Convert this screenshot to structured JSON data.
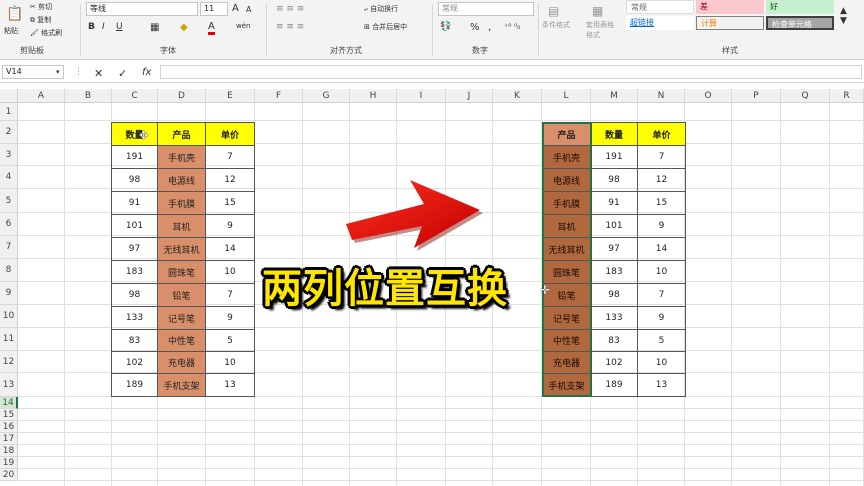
{
  "ribbon": {
    "clipboard": {
      "paste": "粘贴",
      "cut": "剪切",
      "copy": "复制",
      "format_painter": "格式刷",
      "group": "剪贴板"
    },
    "font": {
      "name": "等线",
      "size": "11",
      "bold": "B",
      "italic": "I",
      "underline": "U",
      "grow": "A",
      "shrink": "A",
      "font_color": "A",
      "wen": "wén",
      "group": "字体"
    },
    "alignment": {
      "wrap": "自动换行",
      "merge": "合并后居中",
      "group": "对齐方式"
    },
    "number": {
      "format": "常规",
      "percent": "%",
      "comma": ",",
      "group": "数字"
    },
    "styles": {
      "conditional": "条件格式",
      "table": "套用表格格式",
      "normal": "常规",
      "bad": "差",
      "good": "好",
      "hyperlink": "超链接",
      "calc": "计算",
      "check": "检查单元格",
      "group": "样式"
    }
  },
  "formula_bar": {
    "name_box": "V14",
    "cancel": "✕",
    "enter": "✓",
    "fx": "fx",
    "value": ""
  },
  "columns": [
    "A",
    "B",
    "C",
    "D",
    "E",
    "F",
    "G",
    "H",
    "I",
    "J",
    "K",
    "L",
    "M",
    "N",
    "O",
    "P",
    "Q",
    "R"
  ],
  "rows": [
    "1",
    "2",
    "3",
    "4",
    "5",
    "6",
    "7",
    "8",
    "9",
    "10",
    "11",
    "12",
    "13",
    "14",
    "15",
    "16",
    "17",
    "18",
    "19",
    "20"
  ],
  "left_table": {
    "headers": [
      "数量",
      "产品",
      "单价"
    ],
    "rows": [
      [
        "191",
        "手机壳",
        "7"
      ],
      [
        "98",
        "电源线",
        "12"
      ],
      [
        "91",
        "手机膜",
        "15"
      ],
      [
        "101",
        "耳机",
        "9"
      ],
      [
        "97",
        "无线耳机",
        "14"
      ],
      [
        "183",
        "圆珠笔",
        "10"
      ],
      [
        "98",
        "铅笔",
        "7"
      ],
      [
        "133",
        "记号笔",
        "9"
      ],
      [
        "83",
        "中性笔",
        "5"
      ],
      [
        "102",
        "充电器",
        "10"
      ],
      [
        "189",
        "手机支架",
        "13"
      ]
    ]
  },
  "right_table": {
    "headers": [
      "产品",
      "数量",
      "单价"
    ],
    "rows": [
      [
        "手机壳",
        "191",
        "7"
      ],
      [
        "电源线",
        "98",
        "12"
      ],
      [
        "手机膜",
        "91",
        "15"
      ],
      [
        "耳机",
        "101",
        "9"
      ],
      [
        "无线耳机",
        "97",
        "14"
      ],
      [
        "圆珠笔",
        "183",
        "10"
      ],
      [
        "铅笔",
        "98",
        "7"
      ],
      [
        "记号笔",
        "133",
        "9"
      ],
      [
        "中性笔",
        "83",
        "5"
      ],
      [
        "充电器",
        "102",
        "10"
      ],
      [
        "手机支架",
        "189",
        "13"
      ]
    ]
  },
  "caption": "两列位置互换",
  "colors": {
    "header_yellow": "#ffff00",
    "product_orange": "#d9906a",
    "arrow_red": "#e81010",
    "caption_yellow": "#ffe600"
  }
}
